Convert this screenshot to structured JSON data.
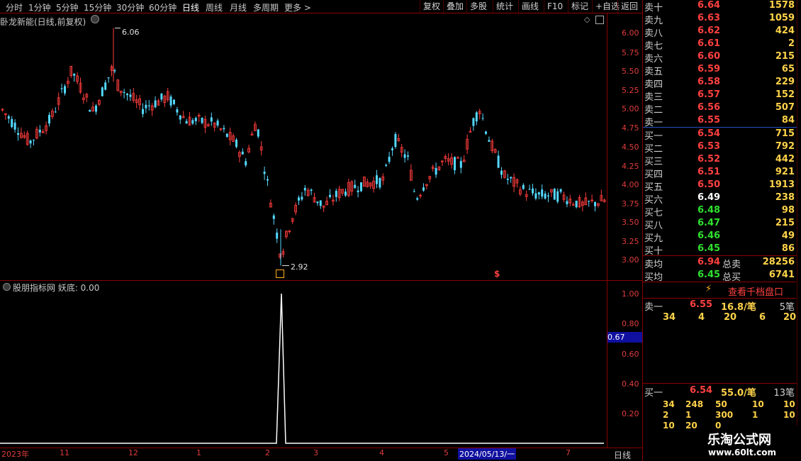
{
  "toolbar": {
    "periods": [
      "分时",
      "1分钟",
      "5分钟",
      "15分钟",
      "30分钟",
      "60分钟",
      "日线",
      "周线",
      "月线",
      "多周期",
      "更多 >"
    ],
    "active_period": "日线",
    "right_buttons": [
      "复权",
      "叠加",
      "多股",
      "统计",
      "画线",
      "F10",
      "标记",
      "+自选",
      "返回"
    ]
  },
  "main_chart": {
    "title": "卧龙新能(日线,前复权)",
    "y_ticks": [
      "6.00",
      "5.75",
      "5.50",
      "5.25",
      "5.00",
      "4.75",
      "4.50",
      "4.25",
      "4.00",
      "3.75",
      "3.50",
      "3.25",
      "3.00"
    ],
    "high_marker": "6.06",
    "low_marker": "2.92",
    "signal_mark": "$"
  },
  "indicator": {
    "title": "股朋指标网 妖底: 0.00",
    "y_ticks": [
      "1.00",
      "0.80",
      "0.60",
      "0.40",
      "0.20"
    ],
    "cursor_value": "0.67"
  },
  "x_axis": {
    "labels": [
      "2023年",
      "11",
      "12",
      "1",
      "2",
      "3",
      "4",
      "5",
      "2024/05/13/一",
      "7"
    ],
    "period_tag": "日线"
  },
  "order_book": {
    "asks": [
      {
        "label": "卖十",
        "price": "6.64",
        "vol": "1578"
      },
      {
        "label": "卖九",
        "price": "6.63",
        "vol": "1059"
      },
      {
        "label": "卖八",
        "price": "6.62",
        "vol": "424"
      },
      {
        "label": "卖七",
        "price": "6.61",
        "vol": "2"
      },
      {
        "label": "卖六",
        "price": "6.60",
        "vol": "215"
      },
      {
        "label": "卖五",
        "price": "6.59",
        "vol": "65"
      },
      {
        "label": "卖四",
        "price": "6.58",
        "vol": "229"
      },
      {
        "label": "卖三",
        "price": "6.57",
        "vol": "152"
      },
      {
        "label": "卖二",
        "price": "6.56",
        "vol": "507"
      },
      {
        "label": "卖一",
        "price": "6.55",
        "vol": "84"
      }
    ],
    "bids": [
      {
        "label": "买一",
        "price": "6.54",
        "vol": "715"
      },
      {
        "label": "买二",
        "price": "6.53",
        "vol": "792"
      },
      {
        "label": "买三",
        "price": "6.52",
        "vol": "442"
      },
      {
        "label": "买四",
        "price": "6.51",
        "vol": "921"
      },
      {
        "label": "买五",
        "price": "6.50",
        "vol": "1913"
      },
      {
        "label": "买六",
        "price": "6.49",
        "vol": "238"
      },
      {
        "label": "买七",
        "price": "6.48",
        "vol": "98"
      },
      {
        "label": "买八",
        "price": "6.47",
        "vol": "215"
      },
      {
        "label": "买九",
        "price": "6.46",
        "vol": "49"
      },
      {
        "label": "买十",
        "price": "6.45",
        "vol": "86"
      }
    ],
    "avg_sell": {
      "label": "卖均",
      "price": "6.94",
      "total_label": "总卖",
      "total": "28256"
    },
    "avg_buy": {
      "label": "买均",
      "price": "6.45",
      "total_label": "总买",
      "total": "6741"
    },
    "thousand_btn": "查看千档盘口",
    "sell1_detail": {
      "label": "卖一",
      "price": "6.55",
      "per": "16.8/笔",
      "count": "5笔",
      "queue": [
        "34",
        "4",
        "20",
        "6",
        "20"
      ]
    },
    "buy1_detail": {
      "label": "买一",
      "price": "6.54",
      "per": "55.0/笔",
      "count": "13笔",
      "queue": [
        [
          "34",
          "248",
          "50",
          "10",
          "10"
        ],
        [
          "2",
          "1",
          "300",
          "1",
          "10"
        ],
        [
          "10",
          "20",
          "0"
        ]
      ]
    }
  },
  "watermark": {
    "line1": "乐淘公式网",
    "line2": "www.60lt.com"
  },
  "colors": {
    "up": "#ff3c3c",
    "down": "#54d8ff",
    "border": "#8b0000",
    "indicator_line": "#ffffff"
  }
}
